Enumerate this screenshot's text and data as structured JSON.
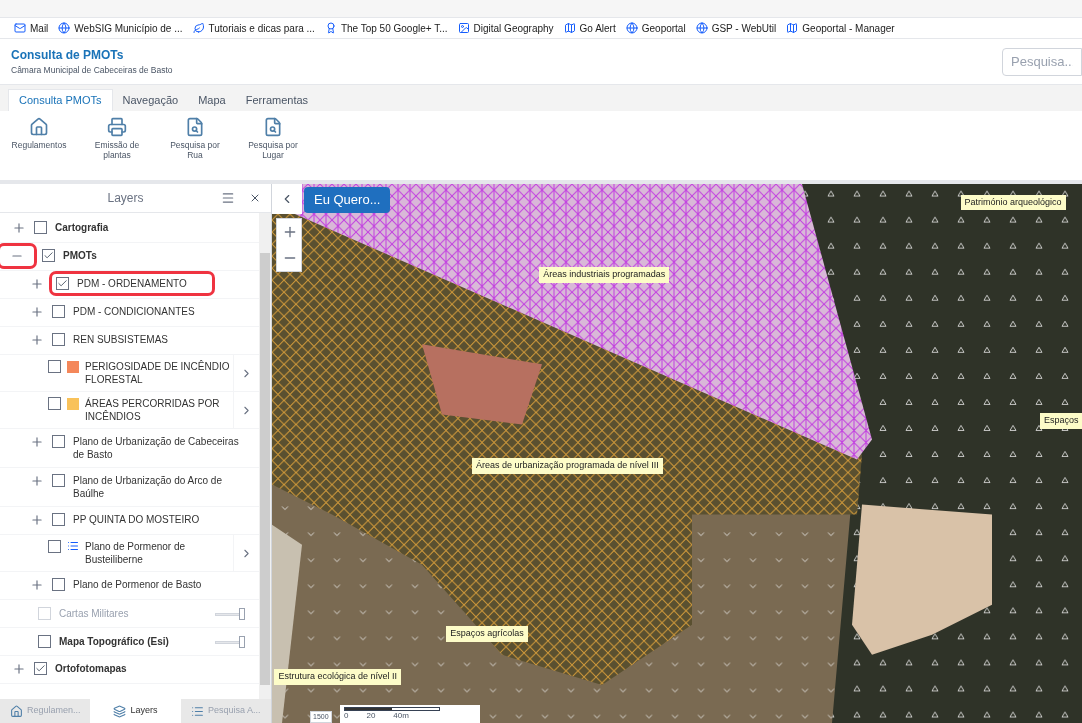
{
  "bookmarks": [
    {
      "label": "Mail"
    },
    {
      "label": "WebSIG Município de ..."
    },
    {
      "label": "Tutoriais e dicas para ..."
    },
    {
      "label": "The Top 50 Google+ T..."
    },
    {
      "label": "Digital Geography"
    },
    {
      "label": "Go Alert"
    },
    {
      "label": "Geoportal"
    },
    {
      "label": "GSP - WebUtil"
    },
    {
      "label": "Geoportal - Manager"
    }
  ],
  "header": {
    "title": "Consulta de PMOTs",
    "subtitle": "Câmara Municipal de Cabeceiras de Basto",
    "search": {
      "placeholder": "Pesquisa..."
    }
  },
  "tabs": [
    {
      "label": "Consulta PMOTs",
      "selected": true
    },
    {
      "label": "Navegação",
      "selected": false
    },
    {
      "label": "Mapa",
      "selected": false
    },
    {
      "label": "Ferramentas",
      "selected": false
    }
  ],
  "tools": [
    {
      "label": "Regulamentos"
    },
    {
      "label": "Emissão de plantas"
    },
    {
      "label": "Pesquisa por Rua"
    },
    {
      "label": "Pesquisa por Lugar"
    }
  ],
  "layers_panel": {
    "title": "Layers",
    "items": [
      {
        "kind": "group",
        "label": "Cartografia",
        "checked": false,
        "expanded": false,
        "highlighted": false
      },
      {
        "kind": "group",
        "label": "PMOTs",
        "checked": true,
        "expanded": true,
        "highlighted": true,
        "children": [
          {
            "kind": "group",
            "label": "PDM - ORDENAMENTO",
            "checked": true,
            "expanded": false,
            "highlighted": true
          },
          {
            "kind": "group",
            "label": "PDM - CONDICIONANTES",
            "checked": false,
            "expanded": false,
            "highlighted": false
          },
          {
            "kind": "group",
            "label": "REN SUBSISTEMAS",
            "checked": false,
            "expanded": false,
            "highlighted": false
          },
          {
            "kind": "swatch",
            "label": "PERIGOSIDADE DE INCÊNDIO FLORESTAL",
            "checked": false,
            "color": "#f4875a"
          },
          {
            "kind": "swatch",
            "label": "ÁREAS PERCORRIDAS POR INCÊNDIOS",
            "checked": false,
            "color": "#f9c25a"
          },
          {
            "kind": "group",
            "label": "Plano de Urbanização de Cabeceiras de Basto",
            "checked": false,
            "expanded": false,
            "highlighted": false
          },
          {
            "kind": "group",
            "label": "Plano de Urbanização do Arco de Baúlhe",
            "checked": false,
            "expanded": false,
            "highlighted": false
          },
          {
            "kind": "group",
            "label": "PP QUINTA DO MOSTEIRO",
            "checked": false,
            "expanded": false,
            "highlighted": false
          },
          {
            "kind": "legend",
            "label": "Plano de Pormenor de Busteiliberne",
            "checked": false
          },
          {
            "kind": "group",
            "label": "Plano de Pormenor de Basto",
            "checked": false,
            "expanded": false,
            "highlighted": false
          }
        ]
      },
      {
        "kind": "basemap",
        "label": "Cartas Militares",
        "checked": false,
        "disabled": true,
        "level": 1
      },
      {
        "kind": "basemap",
        "label": "Mapa Topográfico (Esi)",
        "checked": false,
        "disabled": false,
        "level": 1
      },
      {
        "kind": "group",
        "label": "Ortofotomapas",
        "checked": true,
        "expanded": false,
        "highlighted": false
      }
    ]
  },
  "bottom_tabs": [
    {
      "label": "Regulamen...",
      "selected": false
    },
    {
      "label": "Layers",
      "selected": true
    },
    {
      "label": "Pesquisa A...",
      "selected": false
    }
  ],
  "map": {
    "action_button": "Eu Quero...",
    "labels": [
      "Património arqueológico",
      "Áreas industriais programadas",
      "Espaços",
      "Áreas de urbanização programada de nível III",
      "Espaços agrícolas",
      "Estrutura ecológica de nível II"
    ],
    "scale": {
      "ticks": [
        "0",
        "20",
        "40m"
      ],
      "ratio": "1500"
    }
  }
}
